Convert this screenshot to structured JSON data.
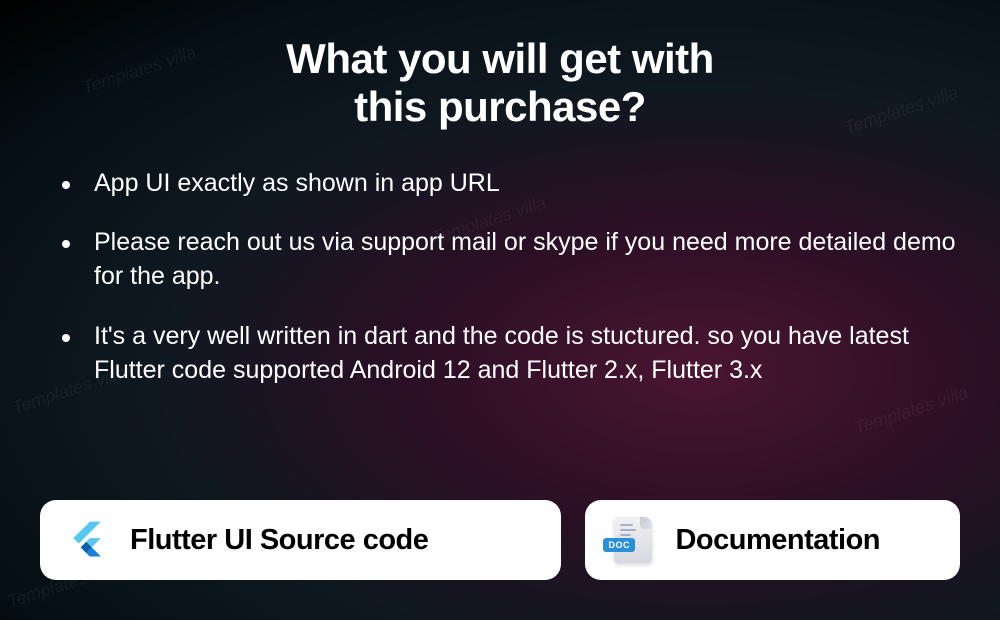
{
  "watermark": "Templates villa",
  "heading_line1": "What you will get with",
  "heading_line2": "this purchase?",
  "bullets": [
    "App UI exactly as shown in app URL",
    "Please reach out us via support mail or skype if you need more detailed demo for the app.",
    "It's a very well written in dart and the code is stuctured. so you have latest Flutter code supported Android 12  and Flutter 2.x, Flutter 3.x"
  ],
  "cards": {
    "flutter": {
      "label": "Flutter UI Source code",
      "icon": "flutter-icon"
    },
    "docs": {
      "label": "Documentation",
      "icon": "document-icon",
      "badge": "DOC"
    }
  }
}
